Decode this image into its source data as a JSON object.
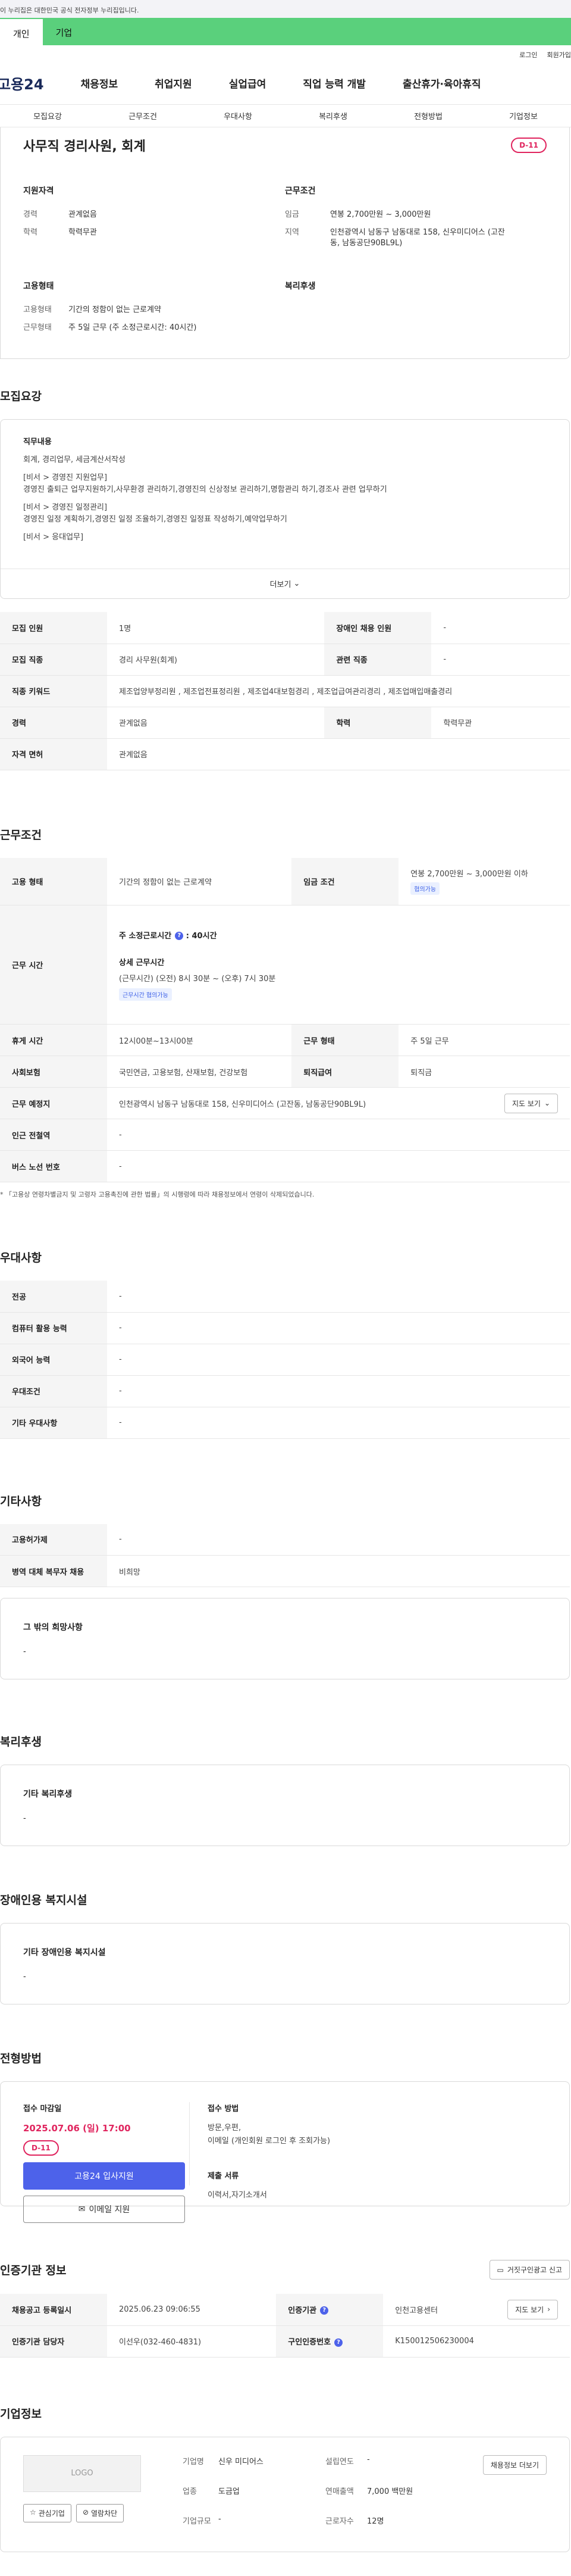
{
  "gov_banner": "이 누리집은 대한민국 공식 전자정부 누리집입니다.",
  "top_tabs": [
    "개인",
    "기업"
  ],
  "util_links": [
    "로그인",
    "회원가입"
  ],
  "logo": "고용24",
  "gnb": [
    "채용정보",
    "취업지원",
    "실업급여",
    "직업 능력 개발",
    "출산휴가·육아휴직"
  ],
  "anchor_nav": [
    "모집요강",
    "근무조건",
    "우대사항",
    "복리후생",
    "전형방법",
    "기업정보"
  ],
  "summary": {
    "title": "사무직 경리사원, 회계",
    "dday": "D-11",
    "qual_head": "지원자격",
    "qual": [
      {
        "k": "경력",
        "v": "관계없음"
      },
      {
        "k": "학력",
        "v": "학력무관"
      }
    ],
    "cond_head": "근무조건",
    "cond": [
      {
        "k": "임금",
        "v": "연봉 2,700만원 ~ 3,000만원"
      },
      {
        "k": "지역",
        "v": "인천광역시 남동구 남동대로 158, 신우미디어스 (고잔동, 남동공단90BL9L)"
      }
    ],
    "emp_head": "고용형태",
    "emp": [
      {
        "k": "고용형태",
        "v": "기간의 정함이 없는 근로계약"
      },
      {
        "k": "근무형태",
        "v": "주 5일 근무 (주 소정근로시간: 40시간)"
      }
    ],
    "welfare_head": "복리후생"
  },
  "recruit": {
    "title": "모집요강",
    "duty_head": "직무내용",
    "duty_lines": [
      "회계, 경리업무, 세금계산서작성",
      "[비서 > 경영진 지원업무]\n경영진 출퇴근 업무지원하기,사무환경 관리하기,경영진의 신상정보 관리하기,명함관리 하기,경조사 관련 업무하기",
      "[비서 > 경영진 일정관리]\n경영진 일정 계획하기,경영진 일정 조율하기,경영진 일정표 작성하기,예약업무하기",
      "[비서 > 응대업무]"
    ],
    "more": "더보기",
    "rows": [
      [
        {
          "k": "모집 인원",
          "v": "1명"
        },
        {
          "k": "장애인 채용 인원",
          "v": "-"
        }
      ],
      [
        {
          "k": "모집 직종",
          "v": "경리 사무원(회계)"
        },
        {
          "k": "관련 직종",
          "v": "-"
        }
      ],
      [
        {
          "k": "직종 키워드",
          "v": "제조업양부정리원 , 제조업전표정리원 , 제조업4대보험경리 , 제조업급여관리경리 , 제조업매입매출경리"
        }
      ],
      [
        {
          "k": "경력",
          "v": "관계없음"
        },
        {
          "k": "학력",
          "v": "학력무관"
        }
      ],
      [
        {
          "k": "자격 면허",
          "v": "관계없음"
        }
      ]
    ]
  },
  "work": {
    "title": "근무조건",
    "employment_type_k": "고용 형태",
    "employment_type_v": "기간의 정함이 없는 근로계약",
    "wage_k": "임금 조건",
    "wage_v": "연봉 2,700만원 ~ 3,000만원 이하",
    "wage_tag": "협의가능",
    "hours_k": "근무 시간",
    "hours_total_label": "주 소정근로시간",
    "hours_total_v": "40시간",
    "hours_detail_label": "상세 근무시간",
    "hours_detail_v": "(근무시간) (오전) 8시 30분 ~ (오후) 7시 30분",
    "hours_tag": "근무시간 협의가능",
    "break_k": "휴게 시간",
    "break_v": "12시00분~13시00분",
    "shift_k": "근무 형태",
    "shift_v": "주 5일 근무",
    "ins_k": "사회보험",
    "ins_v": "국민연금, 고용보험, 산재보험, 건강보험",
    "retire_k": "퇴직급여",
    "retire_v": "퇴직금",
    "place_k": "근무 예정지",
    "place_v": "인천광역시 남동구 남동대로 158, 신우미디어스 (고잔동, 남동공단90BL9L)",
    "map_btn": "지도 보기",
    "station_k": "인근 전철역",
    "station_v": "-",
    "bus_k": "버스 노선 번호",
    "bus_v": "-",
    "note": "* 「고용상 연령차별금지 및 고령자 고용촉진에 관한 법률」의 시행령에 따라 채용정보에서 연령이 삭제되었습니다."
  },
  "pref": {
    "title": "우대사항",
    "rows": [
      {
        "k": "전공",
        "v": "-"
      },
      {
        "k": "컴퓨터 활용 능력",
        "v": "-"
      },
      {
        "k": "외국어 능력",
        "v": "-"
      },
      {
        "k": "우대조건",
        "v": "-"
      },
      {
        "k": "기타 우대사항",
        "v": "-"
      }
    ]
  },
  "etc": {
    "title": "기타사항",
    "rows": [
      {
        "k": "고용허가제",
        "v": "-"
      },
      {
        "k": "병역 대체 복무자 채용",
        "v": "비희망"
      }
    ],
    "wish_head": "그 밖의 희망사항",
    "wish_v": "-"
  },
  "welfare": {
    "title": "복리후생",
    "head": "기타 복리후생",
    "v": "-"
  },
  "disabled": {
    "title": "장애인용 복지시설",
    "head": "기타 장애인용 복지시설",
    "v": "-"
  },
  "process": {
    "title": "전형방법",
    "deadline_head": "접수 마감일",
    "deadline_v": "2025.07.06 (일) 17:00",
    "dday": "D-11",
    "apply_btn": "고용24 입사지원",
    "email_btn": "이메일 지원",
    "method_head": "접수 방법",
    "method_v": "방문,우편,\n이메일 (개인회원 로그인 후 조회가능)",
    "docs_head": "제출 서류",
    "docs_v": "이력서,자기소개서"
  },
  "cert": {
    "title": "인증기관 정보",
    "fraud_btn": "거짓구인광고 신고",
    "reg_k": "채용공고 등록일시",
    "reg_v": "2025.06.23 09:06:55",
    "org_k": "인증기관",
    "org_v": "인천고용센터",
    "map_btn": "지도 보기",
    "mgr_k": "인증기관 담당자",
    "mgr_v": "이선우(032-460-4831)",
    "num_k": "구인인증번호",
    "num_v": "K150012506230004"
  },
  "company": {
    "title": "기업정보",
    "logo_ph": "LOGO",
    "btn_interest": "관심기업",
    "btn_block": "열람차단",
    "btn_jobs": "채용정보 더보기",
    "name_k": "기업명",
    "name_v": "신우 미디어스",
    "year_k": "설립연도",
    "year_v": "-",
    "industry_k": "업종",
    "industry_v": "도금업",
    "sales_k": "연매출액",
    "sales_v": "7,000 백만원",
    "size_k": "기업규모",
    "size_v": "-",
    "emp_k": "근로자수",
    "emp_v": "12명"
  }
}
